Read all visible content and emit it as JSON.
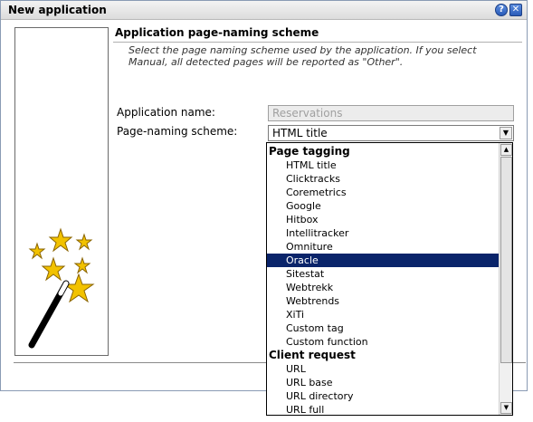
{
  "window": {
    "title": "New application",
    "help_label": "?",
    "close_label": "✕"
  },
  "page": {
    "heading": "Application page-naming scheme",
    "description": "Select the page naming scheme used by the application. If you select Manual, all detected pages will be reported as \"Other\"."
  },
  "form": {
    "app_name_label": "Application name:",
    "app_name_value": "Reservations",
    "scheme_label": "Page-naming scheme:",
    "scheme_value": "HTML title"
  },
  "dropdown": {
    "groups": [
      {
        "label": "Page tagging",
        "items": [
          "HTML title",
          "Clicktracks",
          "Coremetrics",
          "Google",
          "Hitbox",
          "Intellitracker",
          "Omniture",
          "Oracle",
          "Sitestat",
          "Webtrekk",
          "Webtrends",
          "XiTi",
          "Custom tag",
          "Custom function"
        ]
      },
      {
        "label": "Client request",
        "items": [
          "URL",
          "URL base",
          "URL directory",
          "URL full"
        ]
      }
    ],
    "selected": "Oracle"
  },
  "icons": {
    "help": "help-icon",
    "close": "close-icon",
    "wizard": "magic-wand-stars-icon",
    "dropdown_arrow": "chevron-down-icon"
  },
  "colors": {
    "selection": "#0a246a",
    "star": "#f2c200",
    "titlebar": "#e6e6e6"
  }
}
